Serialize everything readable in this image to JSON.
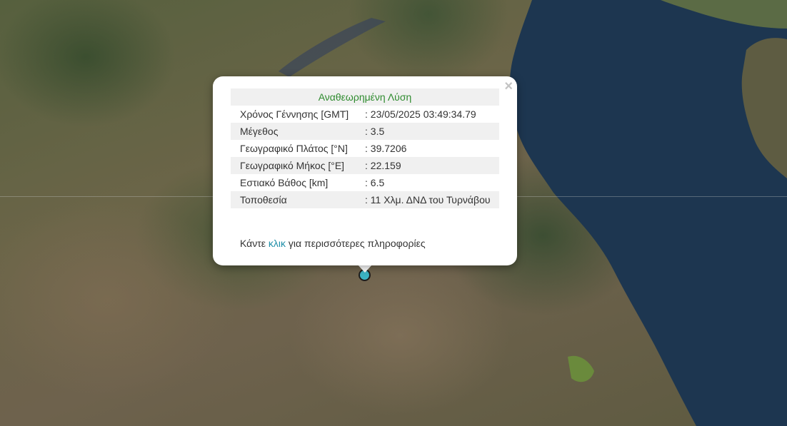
{
  "popup": {
    "header": "Αναθεωρημένη Λύση",
    "close_symbol": "×",
    "rows": [
      {
        "label": "Χρόνος Γέννησης [GMT]",
        "value": ": 23/05/2025 03:49:34.79"
      },
      {
        "label": "Μέγεθος",
        "value": ": 3.5"
      },
      {
        "label": "Γεωγραφικό Πλάτος [°N]",
        "value": ": 39.7206"
      },
      {
        "label": "Γεωγραφικό Μήκος [°E]",
        "value": ": 22.159"
      },
      {
        "label": "Εστιακό Βάθος [km]",
        "value": ": 6.5"
      },
      {
        "label": "Τοποθεσία",
        "value": ": 11 Χλμ. ΔΝΔ του Τυρνάβου"
      }
    ],
    "more_prefix": "Κάντε ",
    "more_link": "κλικ",
    "more_suffix": " για περισσότερες πληροφορίες"
  },
  "map": {
    "marker_icon": "earthquake-epicenter-icon",
    "marker_color": "#3bb3c3",
    "sea_color": "#1d3650",
    "header_color": "#2e8b2e",
    "link_color": "#1f8fa8"
  }
}
